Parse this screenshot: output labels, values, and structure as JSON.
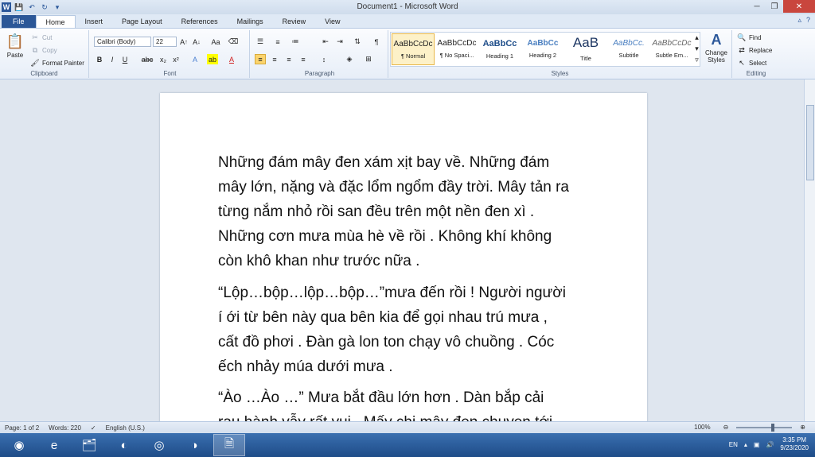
{
  "window": {
    "title": "Document1 - Microsoft Word"
  },
  "tabs": [
    "File",
    "Home",
    "Insert",
    "Page Layout",
    "References",
    "Mailings",
    "Review",
    "View"
  ],
  "clipboard": {
    "paste": "Paste",
    "cut": "Cut",
    "copy": "Copy",
    "format_painter": "Format Painter",
    "label": "Clipboard"
  },
  "font": {
    "name": "Calibri (Body)",
    "size": "22",
    "label": "Font"
  },
  "paragraph": {
    "label": "Paragraph"
  },
  "styles": {
    "items": [
      {
        "preview": "AaBbCcDc",
        "name": "¶ Normal"
      },
      {
        "preview": "AaBbCcDc",
        "name": "¶ No Spaci..."
      },
      {
        "preview": "AaBbCc",
        "name": "Heading 1"
      },
      {
        "preview": "AaBbCc",
        "name": "Heading 2"
      },
      {
        "preview": "AaB",
        "name": "Title"
      },
      {
        "preview": "AaBbCc.",
        "name": "Subtitle"
      },
      {
        "preview": "AaBbCcDc",
        "name": "Subtle Em..."
      }
    ],
    "change_styles": "Change Styles",
    "label": "Styles"
  },
  "editing": {
    "find": "Find",
    "replace": "Replace",
    "select": "Select",
    "label": "Editing"
  },
  "document": {
    "paragraphs": [
      [
        "   Những đám mây đen xám xịt bay về. Những đám",
        "mây lớn, nặng và đặc lổm ngổm đầy trời. Mây tản ra",
        "từng nắm nhỏ rồi san đều trên một nền đen xì .",
        "Những cơn mưa mùa hè về rồi . Không khí không",
        "còn khô khan như trước nữa ."
      ],
      [
        "   “Lộp…bộp…lộp…bộp…”mưa  đến rồi ! Người người",
        "í ới từ bên này qua bên kia để gọi nhau trú mưa ,",
        "cất đồ phơi . Đàn gà lon ton chạy vô chuồng . Cóc",
        "ếch nhảy múa dưới mưa ."
      ],
      [
        "  “Ào …Ào …” Mưa bắt đầu lớn hơn . Dàn bắp cải",
        "       rau hành vẫy rất vui . Mấy chị mây đen chuyen tới"
      ]
    ]
  },
  "status": {
    "page": "Page: 1 of 2",
    "words": "Words: 220",
    "language": "English (U.S.)",
    "zoom": "100%"
  },
  "taskbar": {
    "lang": "EN",
    "time": "3:35 PM",
    "date": "9/23/2020"
  }
}
